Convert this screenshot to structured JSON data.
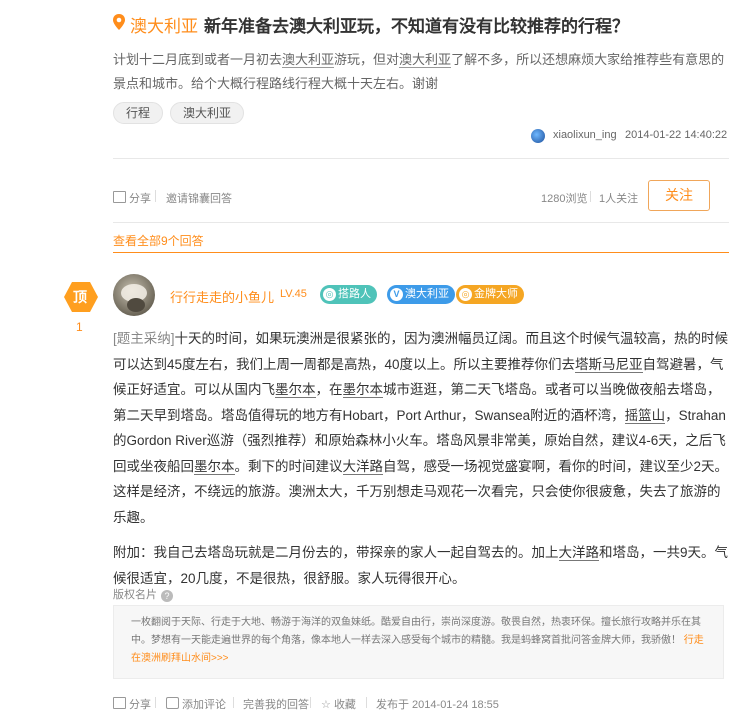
{
  "question": {
    "location": "澳大利亚",
    "title": "新年准备去澳大利亚玩，不知道有没有比较推荐的行程？",
    "desc_1": "计划十二月底到或者一月初去",
    "desc_link_1": "澳大利亚",
    "desc_2": "游玩，但对",
    "desc_link_2": "澳大利亚",
    "desc_3": "了解不多，所以还想麻烦大家给推荐些有意思的景点和城市。给个大概行程路线行程大概十天左右。谢谢",
    "tags": [
      "行程",
      "澳大利亚"
    ],
    "author": "xiaolixun_ing",
    "date": "2014-01-22 14:40:22",
    "share": "分享",
    "invite": "邀请锦囊回答",
    "views": "1280浏览",
    "follows": "1人关注",
    "follow_btn": "关注",
    "view_all": "查看全部9个回答"
  },
  "answer": {
    "top_label": "顶",
    "top_count": "1",
    "name": "行行走走的小鱼儿",
    "level": "LV.45",
    "badges": [
      "搭路人",
      "澳大利亚",
      "金牌大师"
    ],
    "badge_icons": [
      "◎",
      "V",
      "◎"
    ],
    "tagref": "[题主采纳]",
    "p1_a": "十天的时间，如果玩澳洲是很紧张的，因为澳洲幅员辽阔。而且这个时候气温较高，热的时候可以达到45度左右，我们上周一周都是高热，40度以上。所以主要推荐你们去",
    "p1_link1": "塔斯马尼亚",
    "p1_b": "自驾避暑，气候正好适宜。可以从国内飞",
    "p1_link2": "墨尔本",
    "p1_c": "，在",
    "p1_link3": "墨尔本",
    "p1_d": "城市逛逛，第二天飞塔岛。或者可以当晚做夜船去塔岛，第二天早到塔岛。塔岛值得玩的地方有Hobart，Port Arthur，Swansea附近的酒杯湾，",
    "p1_link4": "摇篮山",
    "p1_e": "，Strahan的Gordon River巡游（强烈推荐）和原始森林小火车。塔岛风景非常美，原始自然，建议4-6天，之后飞回或坐夜船回",
    "p1_link5": "墨尔本",
    "p1_f": "。剩下的时间建议",
    "p1_link6": "大洋路",
    "p1_g": "自驾，感受一场视觉盛宴啊，看你的时间，建议至少2天。这样是经济，不绕远的旅游。澳洲太大，千万别想走马观花一次看完，只会使你很疲惫，失去了旅游的乐趣。",
    "p2_a": "附加：我自己去塔岛玩就是二月份去的，带探亲的家人一起自驾去的。加上",
    "p2_link": "大洋路",
    "p2_b": "和塔岛，一共9天。气候很适宜，20几度，不是很热，很舒服。家人玩得很开心。",
    "copyright": "版权名片",
    "sig_text": "一枚翻阅于天际、行走于大地、畅游于海洋的双鱼妹纸。酷爱自由行，崇尚深度游。敬畏自然，热衷环保。擅长旅行攻略并乐在其中。梦想有一天能走遍世界的每个角落，像本地人一样去深入感受每个城市的精髓。我是蚂蜂窝首批问答金牌大师，我骄傲！",
    "sig_link": "行走在澳洲刷拜山水间>>>",
    "footer": {
      "share": "分享",
      "add_comment": "添加评论",
      "improve": "完善我的回答",
      "collect": "收藏",
      "published": "发布于 2014-01-24 18:55"
    }
  },
  "colors": {
    "accent": "#ff8d1b",
    "teal": "#4fc3b9",
    "blue": "#3d9be9",
    "gold": "#f5a623"
  }
}
